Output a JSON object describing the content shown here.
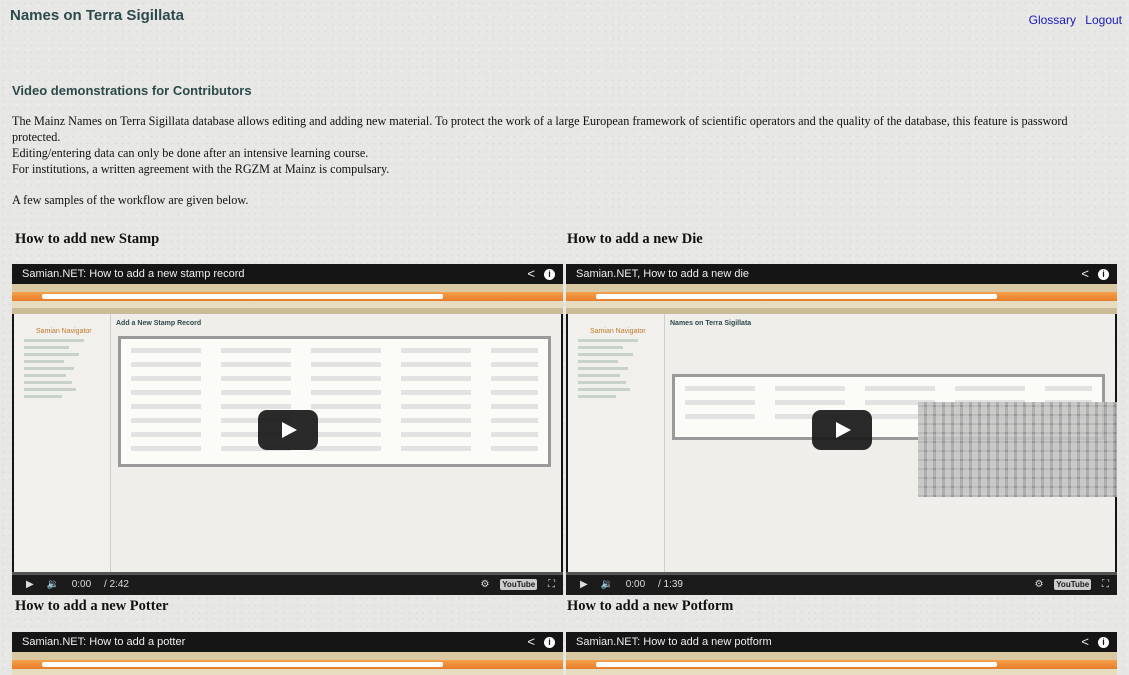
{
  "header": {
    "site_title": "Names on Terra Sigillata",
    "links": [
      "Glossary",
      "Logout"
    ]
  },
  "section": {
    "heading": "Video demonstrations for Contributors",
    "paragraphs": [
      "The Mainz Names on Terra Sigillata database allows editing and adding new material. To protect the work of a large European framework of scientific operators and the quality of the database, this feature is password protected.",
      "Editing/entering data can only be done after an intensive learning course.",
      "For institutions, a written agreement with the RGZM at Mainz is compulsary."
    ],
    "samples_note": "A few samples of the workflow are given below."
  },
  "videos": [
    {
      "heading": "How to add new Stamp",
      "player_title": "Samian.NET: How to add a new stamp record",
      "time": "0:00",
      "duration": "2:42",
      "app_nav_title": "Samian Navigator",
      "app_form_heading": "Add a New Stamp Record",
      "watched_fraction": 0
    },
    {
      "heading": "How to add a new Die",
      "player_title": "Samian.NET, How to add a new die",
      "time": "0:00",
      "duration": "1:39",
      "app_nav_title": "Samian Navigator",
      "app_form_heading": "Names on Terra Sigillata",
      "watched_fraction": 0
    },
    {
      "heading": "How to add a new Potter",
      "player_title": "Samian.NET: How to add a potter"
    },
    {
      "heading": "How to add a new Potform",
      "player_title": "Samian.NET: How to add a new potform"
    }
  ],
  "icons": {
    "share": "share-icon",
    "info": "info-icon",
    "play": "play-icon",
    "volume": "volume-icon",
    "settings": "settings-icon",
    "youtube": "youtube-logo",
    "fullscreen": "fullscreen-icon"
  },
  "colors": {
    "link": "#1a1ab8",
    "heading": "#2d4a4a",
    "player_bg": "#151515",
    "firefox_toolbar": "#e87c2a"
  }
}
